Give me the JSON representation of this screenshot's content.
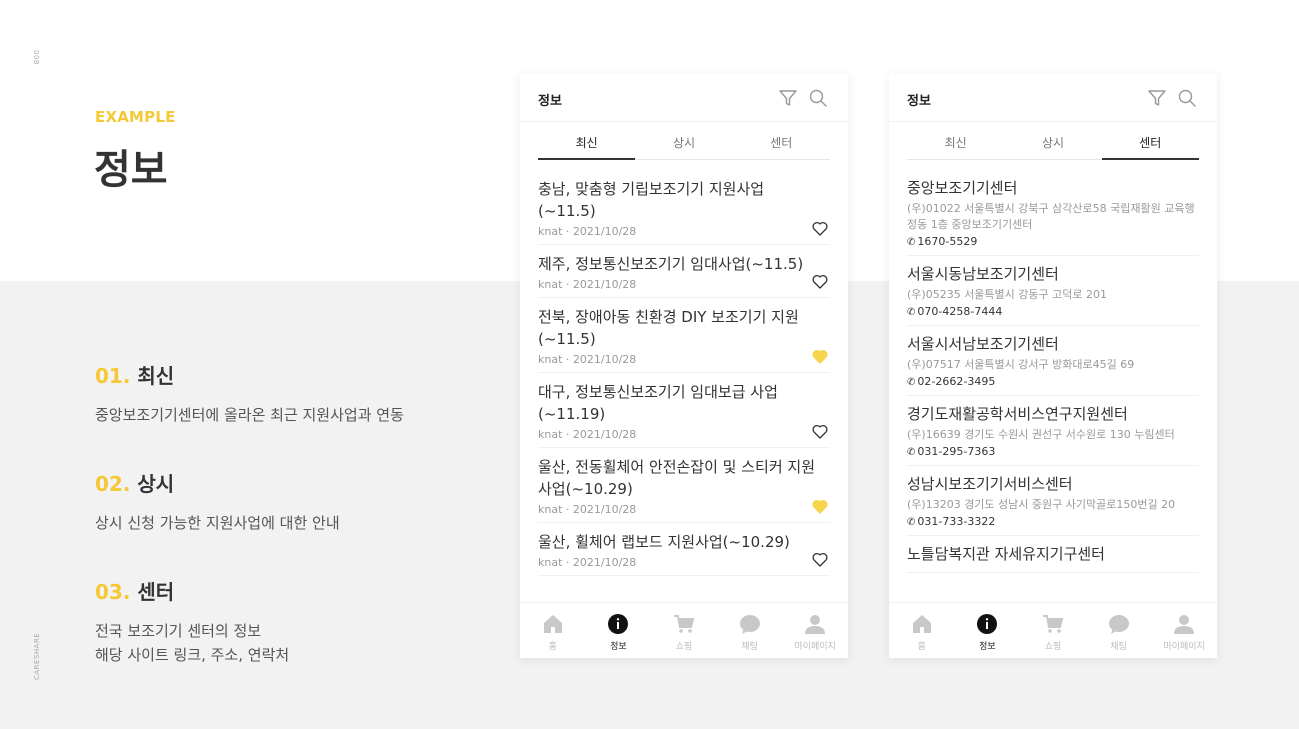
{
  "page": {
    "number": "008",
    "brand": "CARESHARE",
    "example_label": "EXAMPLE",
    "title": "정보"
  },
  "features": [
    {
      "num": "01.",
      "title": "최신",
      "desc_lines": [
        "중앙보조기기센터에 올라온 최근 지원사업과 연동"
      ]
    },
    {
      "num": "02.",
      "title": "상시",
      "desc_lines": [
        "상시 신청 가능한 지원사업에 대한 안내"
      ]
    },
    {
      "num": "03.",
      "title": "센터",
      "desc_lines": [
        "전국 보조기기 센터의 정보",
        "해당 사이트 링크, 주소, 연락처"
      ]
    }
  ],
  "phone1": {
    "title": "정보",
    "tabs": [
      "최신",
      "상시",
      "센터"
    ],
    "active_tab": 0,
    "posts": [
      {
        "title": "충남, 맞춤형 기립보조기기 지원사업(~11.5)",
        "meta": "knat · 2021/10/28",
        "liked": false
      },
      {
        "title": "제주, 정보통신보조기기 임대사업(~11.5)",
        "meta": "knat · 2021/10/28",
        "liked": false
      },
      {
        "title": "전북, 장애아동 친환경 DIY 보조기기 지원(~11.5)",
        "meta": "knat · 2021/10/28",
        "liked": true
      },
      {
        "title": "대구, 정보통신보조기기 임대보급 사업(~11.19)",
        "meta": "knat · 2021/10/28",
        "liked": false
      },
      {
        "title": "울산, 전동휠체어 안전손잡이 및 스티커 지원사업(~10.29)",
        "meta": "knat · 2021/10/28",
        "liked": true
      },
      {
        "title": "울산, 휠체어 랩보드 지원사업(~10.29)",
        "meta": "knat · 2021/10/28",
        "liked": false
      }
    ]
  },
  "phone2": {
    "title": "정보",
    "tabs": [
      "최신",
      "상시",
      "센터"
    ],
    "active_tab": 2,
    "centers": [
      {
        "name": "중앙보조기기센터",
        "addr": "(우)01022 서울특별시 강북구 삼각산로58 국립재활원 교육행정동 1층 중앙보조기기센터",
        "phone": "1670-5529"
      },
      {
        "name": "서울시동남보조기기센터",
        "addr": "(우)05235 서울특별시 강동구 고덕로 201",
        "phone": "070-4258-7444"
      },
      {
        "name": "서울시서남보조기기센터",
        "addr": "(우)07517 서울특별시 강서구 방화대로45길 69",
        "phone": "02-2662-3495"
      },
      {
        "name": "경기도재활공학서비스연구지원센터",
        "addr": "(우)16639 경기도 수원시 권선구 서수원로 130 누림센터",
        "phone": "031-295-7363"
      },
      {
        "name": "성남시보조기기서비스센터",
        "addr": "(우)13203 경기도 성남시 중원구 사기막골로150번길 20",
        "phone": "031-733-3322"
      },
      {
        "name": "노틀담복지관 자세유지기구센터",
        "addr": "",
        "phone": ""
      }
    ]
  },
  "bottom_nav": [
    "홈",
    "정보",
    "쇼핑",
    "채팅",
    "마이페이지"
  ],
  "bottom_nav_active": 1,
  "colors": {
    "accent": "#f5c836",
    "heart_filled": "#f7d54a",
    "text_dark": "#333333",
    "muted": "#999999"
  },
  "icons": {
    "filter": "filter-icon",
    "search": "search-icon",
    "heart": "heart-icon",
    "home": "home-icon",
    "info": "info-icon",
    "cart": "cart-icon",
    "chat": "chat-icon",
    "user": "user-icon"
  }
}
